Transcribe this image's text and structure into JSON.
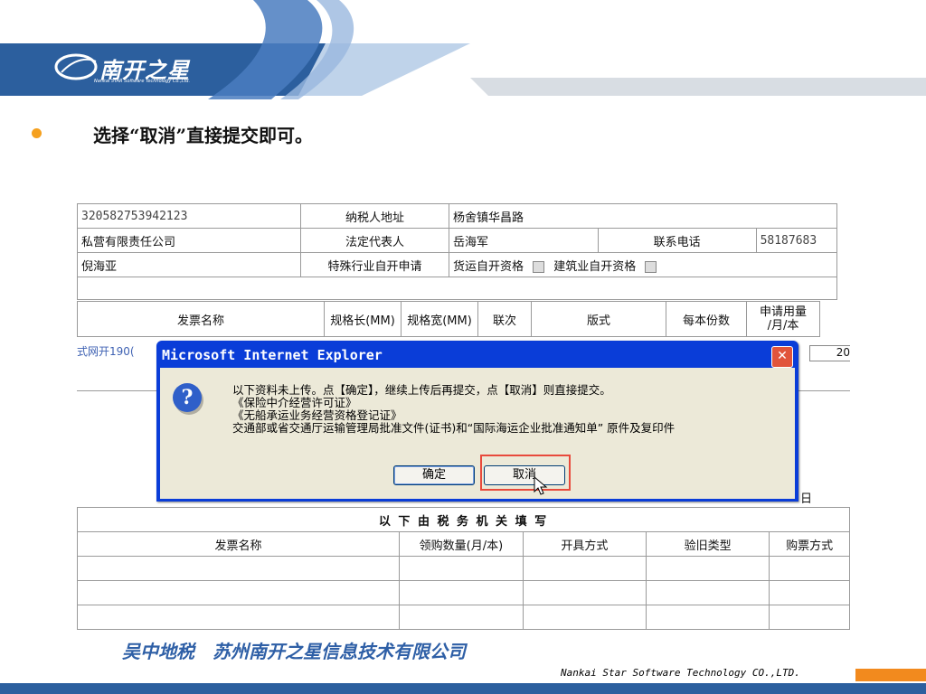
{
  "logo": {
    "name": "南开之星",
    "sub": "Nankai STAR Software Technology Co.,Ltd."
  },
  "instruction": "选择“取消”直接提交即可。",
  "form": {
    "row1": {
      "tax_id": "320582753942123",
      "addr_label": "纳税人地址",
      "addr_value": "杨舍镇华昌路"
    },
    "row2": {
      "type": "私营有限责任公司",
      "rep_label": "法定代表人",
      "rep_value": "岳海军",
      "phone_label": "联系电话",
      "phone_value": "58187683"
    },
    "row3": {
      "person": "倪海亚",
      "special_label": "特殊行业自开申请",
      "freight": "货运自开资格",
      "construction": "建筑业自开资格"
    },
    "header": [
      "发票名称",
      "规格长(MM)",
      "规格宽(MM)",
      "联次",
      "版式",
      "每本份数",
      "申请用量/月/本"
    ],
    "header_usage_line1": "申请用量",
    "header_usage_line2": "/月/本",
    "data_row": {
      "name": "式网开190(",
      "qty": "20"
    },
    "day_char": "日",
    "section_title": "以 下 由 税 务 机 关 填 写",
    "lower_header": [
      "发票名称",
      "领购数量(月/本)",
      "开具方式",
      "验旧类型",
      "购票方式"
    ]
  },
  "dialog": {
    "title": "Microsoft Internet Explorer",
    "close": "✕",
    "icon": "?",
    "lines": [
      "以下资料未上传。点【确定】，继续上传后再提交，点【取消】则直接提交。",
      "《保险中介经营许可证》",
      "《无船承运业务经营资格登记证》",
      "交通部或省交通厅运输管理局批准文件(证书)和“国际海运企业批准通知单” 原件及复印件"
    ],
    "ok": "确定",
    "cancel": "取消"
  },
  "footer": {
    "company": "吴中地税　苏州南开之星信息技术有限公司",
    "en": "Nankai Star Software Technology CO.,LTD."
  },
  "colors": {
    "brand_blue": "#2c5f9e",
    "accent_orange": "#f28a1e",
    "dialog_blue": "#0a3dd8"
  }
}
